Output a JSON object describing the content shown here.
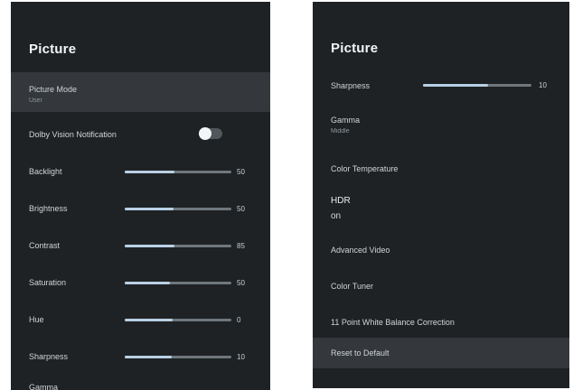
{
  "left_panel": {
    "title": "Picture",
    "picture_mode": {
      "label": "Picture Mode",
      "value": "User"
    },
    "dolby_notification": {
      "label": "Dolby Vision Notification",
      "on": true
    },
    "sliders": [
      {
        "label": "Backlight",
        "value": "50",
        "level": 0.47
      },
      {
        "label": "Brightness",
        "value": "50",
        "level": 0.46
      },
      {
        "label": "Contrast",
        "value": "85",
        "level": 0.47
      },
      {
        "label": "Saturation",
        "value": "50",
        "level": 0.42
      },
      {
        "label": "Hue",
        "value": "0",
        "level": 0.45
      },
      {
        "label": "Sharpness",
        "value": "10",
        "level": 0.44
      }
    ],
    "partial_item": "Gamma"
  },
  "right_panel": {
    "title": "Picture",
    "sharpness": {
      "label": "Sharpness",
      "value": "10",
      "level": 0.6
    },
    "items": [
      {
        "label": "Gamma",
        "sub": "Middle"
      },
      {
        "label": "Color Temperature",
        "sub": ""
      },
      {
        "label": "HDR",
        "sub": "on"
      },
      {
        "label": "Advanced Video",
        "sub": ""
      },
      {
        "label": "Color Tuner",
        "sub": ""
      },
      {
        "label": "11 Point White Balance Correction",
        "sub": ""
      },
      {
        "label": "Reset to Default",
        "sub": ""
      }
    ]
  }
}
